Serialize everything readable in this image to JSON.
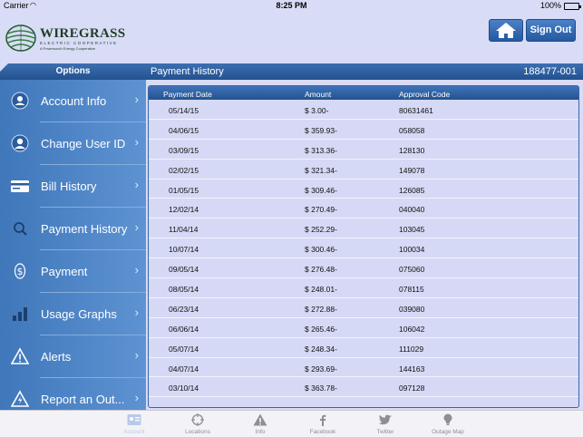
{
  "status_bar": {
    "carrier": "Carrier",
    "time": "8:25 PM",
    "battery": "100%"
  },
  "header": {
    "logo_brand": "WIREGRASS",
    "logo_sub": "ELECTRIC COOPERATIVE",
    "logo_sub2": "A Powersouth Energy Cooperative",
    "signout_label": "Sign Out"
  },
  "sidebar": {
    "title": "Options",
    "items": [
      {
        "label": "Account Info",
        "icon": "person-circle-icon"
      },
      {
        "label": "Change User ID",
        "icon": "user-id-icon"
      },
      {
        "label": "Bill History",
        "icon": "credit-card-icon"
      },
      {
        "label": "Payment History",
        "icon": "magnifier-icon"
      },
      {
        "label": "Payment",
        "icon": "dollar-icon"
      },
      {
        "label": "Usage Graphs",
        "icon": "bar-graph-icon"
      },
      {
        "label": "Alerts",
        "icon": "warning-icon"
      },
      {
        "label": "Report an Out...",
        "icon": "outage-icon"
      }
    ]
  },
  "content": {
    "title": "Payment History",
    "account_number": "188477-001",
    "columns": [
      "Payment Date",
      "Amount",
      "Approval Code"
    ],
    "rows": [
      [
        "05/14/15",
        "$ 3.00-",
        "80631461"
      ],
      [
        "04/06/15",
        "$ 359.93-",
        "058058"
      ],
      [
        "03/09/15",
        "$ 313.36-",
        "128130"
      ],
      [
        "02/02/15",
        "$ 321.34-",
        "149078"
      ],
      [
        "01/05/15",
        "$ 309.46-",
        "126085"
      ],
      [
        "12/02/14",
        "$ 270.49-",
        "040040"
      ],
      [
        "11/04/14",
        "$ 252.29-",
        "103045"
      ],
      [
        "10/07/14",
        "$ 300.46-",
        "100034"
      ],
      [
        "09/05/14",
        "$ 276.48-",
        "075060"
      ],
      [
        "08/05/14",
        "$ 248.01-",
        "078115"
      ],
      [
        "06/23/14",
        "$ 272.88-",
        "039080"
      ],
      [
        "06/06/14",
        "$ 265.46-",
        "106042"
      ],
      [
        "05/07/14",
        "$ 248.34-",
        "111029"
      ],
      [
        "04/07/14",
        "$ 293.69-",
        "144163"
      ],
      [
        "03/10/14",
        "$ 363.78-",
        "097128"
      ]
    ]
  },
  "tabbar": {
    "tabs": [
      {
        "label": "Account",
        "icon": "account-card-icon",
        "active": true
      },
      {
        "label": "Locations",
        "icon": "crosshair-icon",
        "active": false
      },
      {
        "label": "Info",
        "icon": "warning-icon",
        "active": false
      },
      {
        "label": "Facebook",
        "icon": "facebook-icon",
        "active": false
      },
      {
        "label": "Twitter",
        "icon": "twitter-bird-icon",
        "active": false
      },
      {
        "label": "Outage Map",
        "icon": "lightbulb-icon",
        "active": false
      }
    ]
  }
}
